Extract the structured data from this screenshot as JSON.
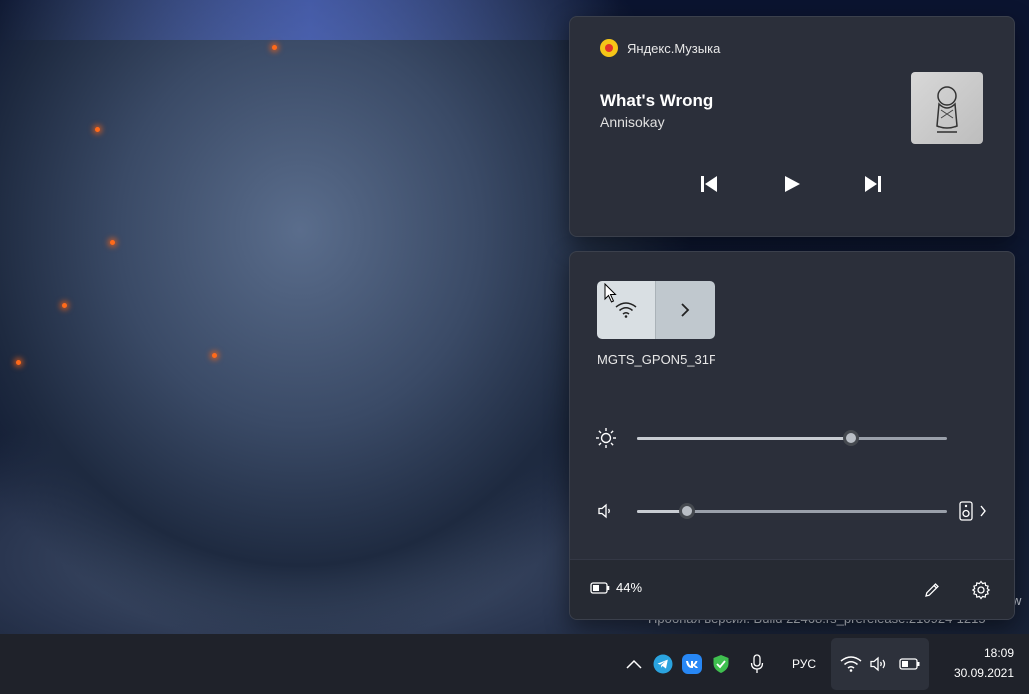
{
  "watermark": {
    "text": "Пробная версия. Build 22468.rs_prerelease.210924-1215",
    "edge_letter": "w"
  },
  "media": {
    "app_name": "Яндекс.Музыка",
    "track_title": "What's Wrong",
    "artist": "Annisokay",
    "album_art_icon": "album-cover",
    "controls": [
      "previous-icon",
      "play-icon",
      "next-icon"
    ]
  },
  "quick_settings": {
    "wifi": {
      "network_name": "MGTS_GPON5_31F",
      "active": true
    },
    "brightness": {
      "icon": "sun-icon",
      "level_percent": 69
    },
    "volume": {
      "icon": "speaker-icon",
      "level_percent": 16,
      "output_icon": "speaker-device-icon"
    },
    "battery": {
      "percent_label": "44%"
    },
    "footer_icons": [
      "pencil-icon",
      "gear-icon"
    ]
  },
  "taskbar": {
    "language": "РУС",
    "time": "18:09",
    "date": "30.09.2021",
    "tray_icons": [
      "chevron-up-icon",
      "telegram-icon",
      "vk-icon",
      "shield-icon",
      "microphone-icon",
      "wifi-icon",
      "volume-icon",
      "battery-icon"
    ],
    "colors": {
      "telegram": "#2aa3df",
      "vk": "#2787f5",
      "shield": "#3fbf4f"
    }
  }
}
